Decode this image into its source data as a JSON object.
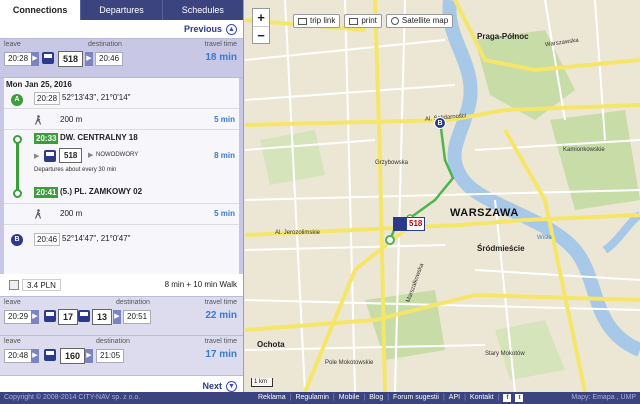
{
  "tabs": [
    {
      "label": "Connections",
      "active": true
    },
    {
      "label": "Departures",
      "active": false
    },
    {
      "label": "Schedules",
      "active": false
    }
  ],
  "nav": {
    "previous": "Previous",
    "next": "Next",
    "up_glyph": "▲",
    "down_glyph": "▼"
  },
  "labels": {
    "leave": "leave",
    "destination": "destination",
    "travel_time": "travel time"
  },
  "connections": [
    {
      "leave": "20:28",
      "lines": [
        "518"
      ],
      "destination": "20:46",
      "travel_time": "18 min"
    },
    {
      "leave": "20:29",
      "lines": [
        "17",
        "13"
      ],
      "destination": "20:51",
      "travel_time": "22 min"
    },
    {
      "leave": "20:48",
      "lines": [
        "160"
      ],
      "destination": "21:05",
      "travel_time": "17 min"
    }
  ],
  "details": {
    "date": "Mon Jan 25, 2016",
    "start": {
      "marker": "A",
      "time": "20:28",
      "coords": "52°13'43\", 21°0'14\""
    },
    "walk1": {
      "distance": "200 m",
      "time": "5 min"
    },
    "board": {
      "time": "20:33",
      "stop": "DW. CENTRALNY 18"
    },
    "ride": {
      "line": "518",
      "direction": "NOWODWORY",
      "time": "8 min",
      "note": "Departures about every 30 min"
    },
    "alight": {
      "time": "20:41",
      "stop": "(5.) PL. ZAMKOWY 02"
    },
    "walk2": {
      "distance": "200 m",
      "time": "5 min"
    },
    "end": {
      "marker": "B",
      "time": "20:46",
      "coords": "52°14'47\", 21°0'47\""
    }
  },
  "price": {
    "value": "3.4 PLN",
    "summary": "8 min + 10 min Walk"
  },
  "map": {
    "zoom_in": "+",
    "zoom_out": "−",
    "tools": {
      "trip_link": "trip link",
      "print": "print",
      "satellite": "Satellite map"
    },
    "scale": "1 km",
    "pin_b": "B",
    "bus_label": "518",
    "labels": {
      "praga_polnoc": "Praga-Północ",
      "warszawa": "WARSZAWA",
      "srodmiescie": "Śródmieście",
      "ochota": "Ochota",
      "kamionkowskie": "Kamionkowskie",
      "stary_mokotow": "Stary Mokotów",
      "al_solidarnosci": "Al. Solidarności",
      "al_jerozolimskie": "Al. Jerozolimskie",
      "grzybowska": "Grzybowska",
      "marszalkowska": "Marszałkowska",
      "wisla": "Wisła",
      "pole_mokotowskie": "Pole Mokotowskie",
      "warszawska": "Warszawska"
    },
    "colors": {
      "water": "#a8c8e8",
      "park": "#c8dca8",
      "major_road": "#f5e66a",
      "road": "#ffffff",
      "route": "#4fb34f"
    }
  },
  "footer": {
    "copyright": "Copyright © 2008-2014 CITY-NAV sp. z o.o.",
    "links": [
      "Reklama",
      "Regulamin",
      "Mobile",
      "Blog",
      "Forum sugestii",
      "API",
      "Kontakt"
    ],
    "social": [
      "f",
      "t"
    ],
    "map_attr": "Mapy: Emapa , UMP"
  }
}
